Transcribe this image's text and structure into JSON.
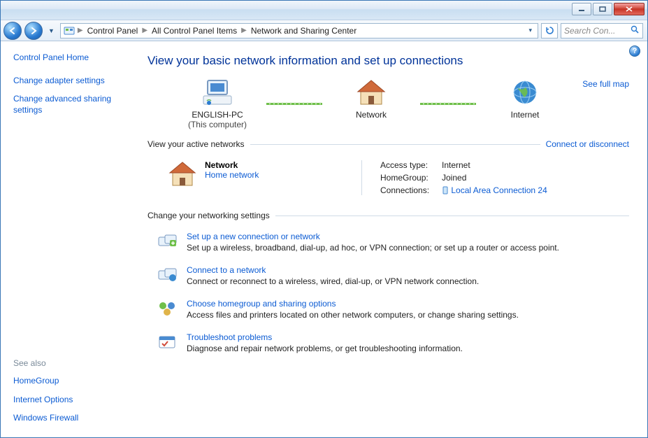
{
  "breadcrumbs": [
    "Control Panel",
    "All Control Panel Items",
    "Network and Sharing Center"
  ],
  "search": {
    "placeholder": "Search Con..."
  },
  "sidebar": {
    "home": "Control Panel Home",
    "tasks": [
      "Change adapter settings",
      "Change advanced sharing settings"
    ],
    "see_also_label": "See also",
    "see_also": [
      "HomeGroup",
      "Internet Options",
      "Windows Firewall"
    ]
  },
  "page": {
    "title": "View your basic network information and set up connections",
    "see_full_map": "See full map",
    "map": {
      "computer": {
        "label": "ENGLISH-PC",
        "sub": "(This computer)"
      },
      "network": {
        "label": "Network"
      },
      "internet": {
        "label": "Internet"
      }
    },
    "active_header": "View your active networks",
    "connect_disconnect": "Connect or disconnect",
    "active": {
      "name": "Network",
      "type": "Home network",
      "access_type_label": "Access type:",
      "access_type_value": "Internet",
      "homegroup_label": "HomeGroup:",
      "homegroup_value": "Joined",
      "connections_label": "Connections:",
      "connections_value": "Local Area Connection 24"
    },
    "settings_header": "Change your networking settings",
    "tasks": [
      {
        "title": "Set up a new connection or network",
        "desc": "Set up a wireless, broadband, dial-up, ad hoc, or VPN connection; or set up a router or access point."
      },
      {
        "title": "Connect to a network",
        "desc": "Connect or reconnect to a wireless, wired, dial-up, or VPN network connection."
      },
      {
        "title": "Choose homegroup and sharing options",
        "desc": "Access files and printers located on other network computers, or change sharing settings."
      },
      {
        "title": "Troubleshoot problems",
        "desc": "Diagnose and repair network problems, or get troubleshooting information."
      }
    ]
  }
}
